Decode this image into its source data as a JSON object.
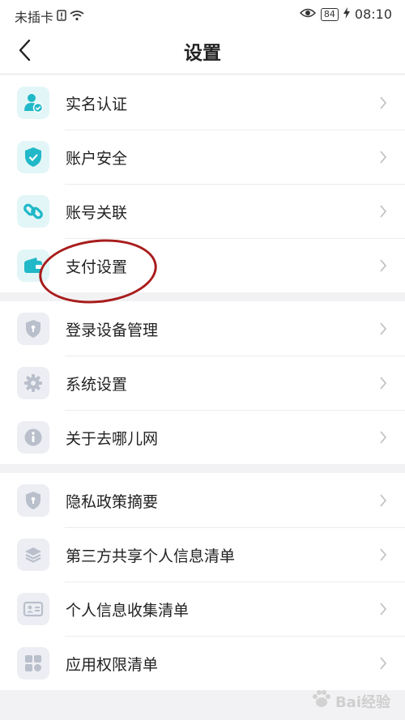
{
  "status_bar": {
    "carrier": "未插卡",
    "battery": "84",
    "time": "08:10"
  },
  "header": {
    "title": "设置"
  },
  "groups": [
    {
      "items": [
        {
          "label": "实名认证",
          "icon": "user-verified-icon"
        },
        {
          "label": "账户安全",
          "icon": "shield-check-icon"
        },
        {
          "label": "账号关联",
          "icon": "link-icon"
        },
        {
          "label": "支付设置",
          "icon": "wallet-icon"
        }
      ]
    },
    {
      "items": [
        {
          "label": "登录设备管理",
          "icon": "device-shield-icon"
        },
        {
          "label": "系统设置",
          "icon": "gear-icon"
        },
        {
          "label": "关于去哪儿网",
          "icon": "info-icon"
        }
      ]
    },
    {
      "items": [
        {
          "label": "隐私政策摘要",
          "icon": "privacy-shield-icon"
        },
        {
          "label": "第三方共享个人信息清单",
          "icon": "layers-icon"
        },
        {
          "label": "个人信息收集清单",
          "icon": "id-card-icon"
        },
        {
          "label": "应用权限清单",
          "icon": "apps-grid-icon"
        }
      ]
    }
  ],
  "colors": {
    "accent_teal": "#21b8c8",
    "icon_gray": "#b9bfcb",
    "annotation": "#a81c1c"
  },
  "watermark": {
    "text": "Bai经验"
  }
}
